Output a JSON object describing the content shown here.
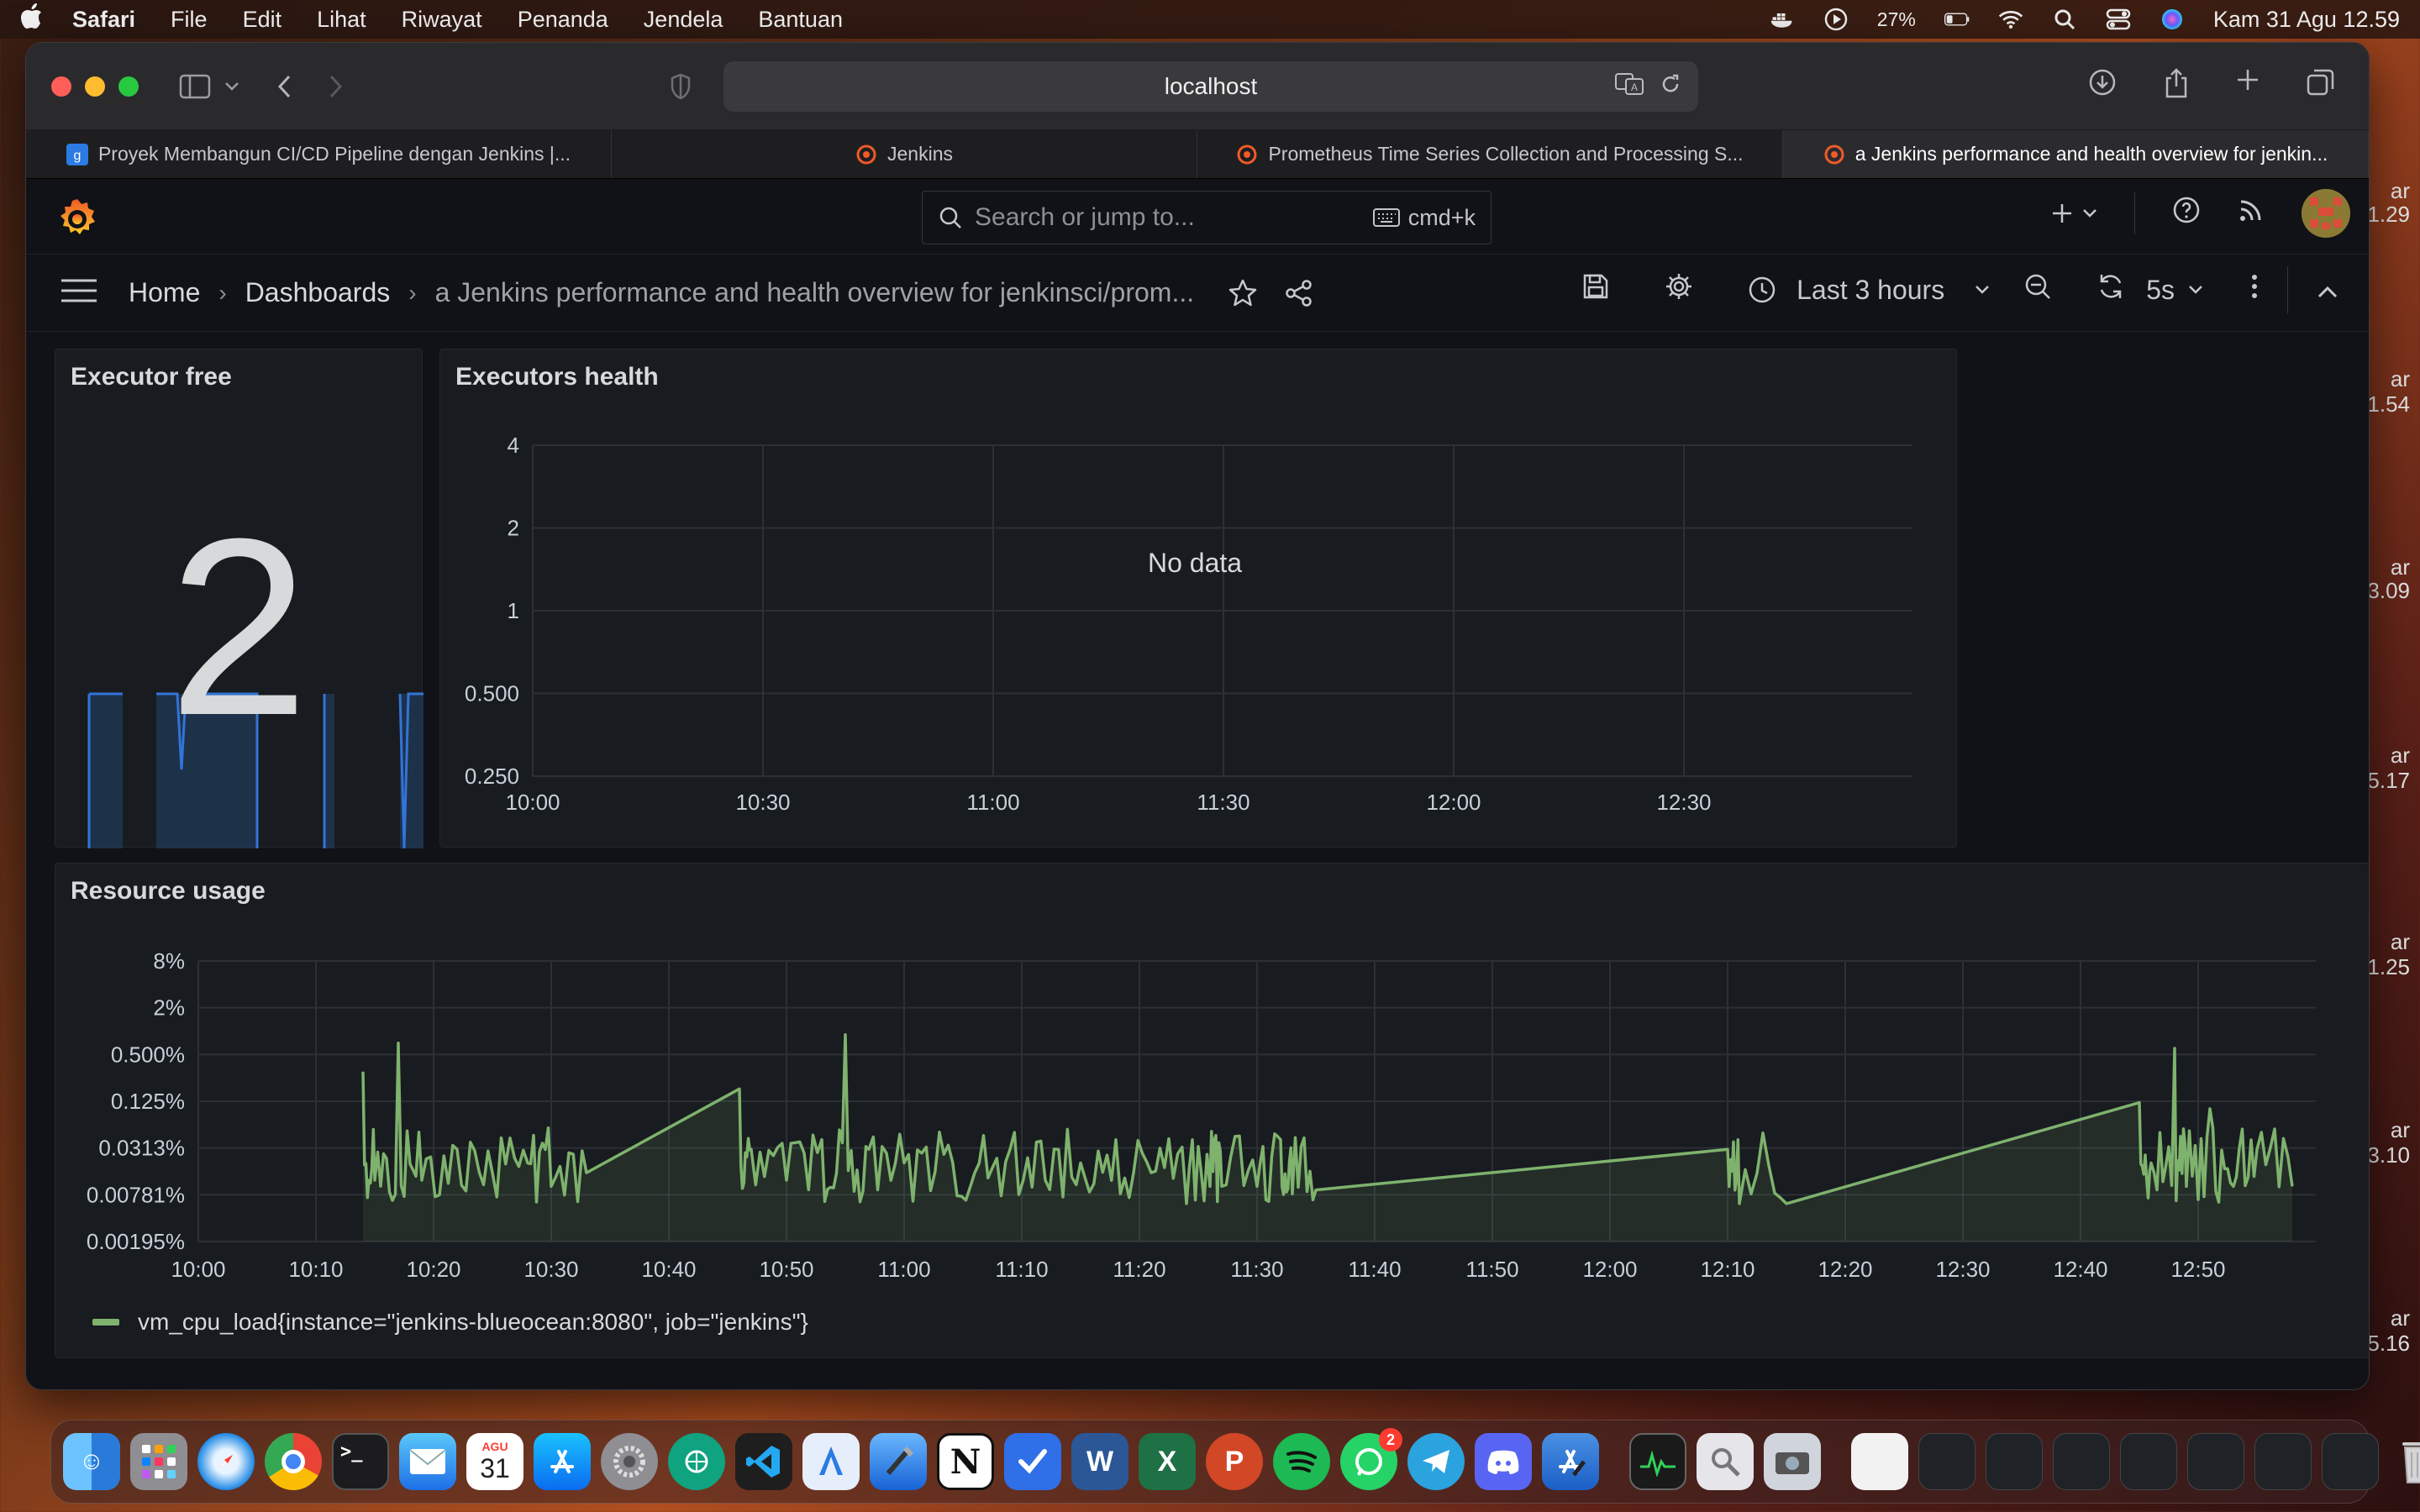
{
  "menubar": {
    "app": "Safari",
    "items": [
      "File",
      "Edit",
      "Lihat",
      "Riwayat",
      "Penanda",
      "Jendela",
      "Bantuan"
    ],
    "battery": "27%",
    "datetime": "Kam 31 Agu  12.59"
  },
  "browser": {
    "url": "localhost",
    "tabs": [
      {
        "label": "Proyek Membangun CI/CD Pipeline dengan Jenkins |...",
        "active": false
      },
      {
        "label": "Jenkins",
        "active": false
      },
      {
        "label": "Prometheus Time Series Collection and Processing S...",
        "active": false
      },
      {
        "label": "a Jenkins performance and health overview for jenkin...",
        "active": true
      }
    ]
  },
  "grafana": {
    "search_placeholder": "Search or jump to...",
    "search_shortcut": "cmd+k",
    "breadcrumb": {
      "home": "Home",
      "dashboards": "Dashboards",
      "current": "a Jenkins performance and health overview for jenkinsci/prom..."
    },
    "time_range": "Last 3 hours",
    "refresh_interval": "5s"
  },
  "panels": {
    "executor_free": {
      "title": "Executor free",
      "value": "2"
    },
    "executors_health": {
      "title": "Executors health",
      "message": "No data",
      "y_ticks": [
        "4",
        "2",
        "1",
        "0.500",
        "0.250"
      ],
      "x_ticks": [
        "10:00",
        "10:30",
        "11:00",
        "11:30",
        "12:00",
        "12:30"
      ]
    },
    "resource_usage": {
      "title": "Resource usage",
      "legend": "vm_cpu_load{instance=\"jenkins-blueocean:8080\", job=\"jenkins\"}",
      "series_color": "#7eb26d"
    }
  },
  "chart_data": {
    "type": "line",
    "title": "Resource usage",
    "xlabel": "",
    "ylabel": "",
    "y_scale": "log2",
    "y_ticks": [
      "8%",
      "2%",
      "0.500%",
      "0.125%",
      "0.0313%",
      "0.00781%",
      "0.00195%"
    ],
    "x_ticks": [
      "10:00",
      "10:10",
      "10:20",
      "10:30",
      "10:40",
      "10:50",
      "11:00",
      "11:10",
      "11:20",
      "11:30",
      "11:40",
      "11:50",
      "12:00",
      "12:10",
      "12:20",
      "12:30",
      "12:40",
      "12:50"
    ],
    "grid": true,
    "legend": "bottom-left",
    "series": [
      {
        "name": "vm_cpu_load{instance=\"jenkins-blueocean:8080\", job=\"jenkins\"}",
        "color": "#7eb26d",
        "x": [
          "10:14",
          "10:15",
          "10:17",
          "10:19",
          "10:22",
          "10:25",
          "10:28",
          "10:30",
          "10:33",
          "10:46",
          "10:47",
          "10:50",
          "10:53",
          "10:55",
          "10:57",
          "11:00",
          "11:03",
          "11:06",
          "11:09",
          "11:12",
          "11:15",
          "11:18",
          "11:21",
          "11:24",
          "11:26",
          "11:27",
          "11:30",
          "11:32",
          "11:33",
          "11:35",
          "12:10",
          "12:11",
          "12:15",
          "12:45",
          "12:46",
          "12:48",
          "12:49",
          "12:51",
          "12:53",
          "12:55",
          "12:58"
        ],
        "y_percent": [
          0.3,
          0.012,
          0.7,
          0.012,
          0.03,
          0.015,
          0.02,
          0.01,
          0.015,
          0.18,
          0.03,
          0.012,
          0.04,
          0.9,
          0.03,
          0.02,
          0.05,
          0.015,
          0.03,
          0.012,
          0.02,
          0.04,
          0.015,
          0.006,
          0.01,
          0.01,
          0.01,
          0.04,
          0.008,
          0.009,
          0.03,
          0.006,
          0.006,
          0.12,
          0.02,
          0.6,
          0.01,
          0.1,
          0.01,
          0.03,
          0.01
        ]
      }
    ]
  },
  "desktop": {
    "right_edge_labels": [
      "ar",
      "1.29",
      "ar",
      "1.54",
      "ar",
      "3.09",
      "ar",
      "5.17",
      "ar",
      "1.25",
      "ar",
      "3.10",
      "ar",
      "5.16"
    ],
    "dock_apps": [
      "Finder",
      "Launchpad",
      "Safari",
      "Chrome",
      "Terminal",
      "Mail",
      "Calendar",
      "App Store",
      "System Settings",
      "ChatGPT",
      "VS Code",
      "Instruments",
      "Xcode",
      "Notion",
      "Tasks",
      "Word",
      "Excel",
      "PowerPoint",
      "Spotify",
      "WhatsApp",
      "Telegram",
      "Discord",
      "Simulator",
      "Activity Monitor",
      "Preview",
      "Screenshot"
    ],
    "dock_calendar_month": "AGU",
    "dock_calendar_day": "31",
    "whatsapp_badge": "2"
  }
}
